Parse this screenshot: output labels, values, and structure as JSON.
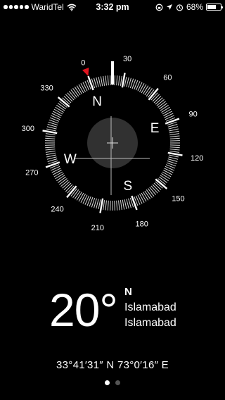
{
  "status_bar": {
    "carrier": "WaridTel",
    "time": "3:32 pm",
    "battery_percent": "68%",
    "battery_level": 0.68,
    "signal_bars": 5,
    "icons": [
      "wifi-icon",
      "rotation-lock-icon",
      "location-arrow-icon",
      "alarm-icon",
      "battery-icon"
    ]
  },
  "compass": {
    "heading_degrees": 20,
    "cardinals": [
      "N",
      "E",
      "S",
      "W"
    ],
    "degree_labels": [
      "0",
      "30",
      "60",
      "90",
      "120",
      "150",
      "180",
      "210",
      "240",
      "270",
      "300",
      "330"
    ],
    "colors": {
      "north_marker": "#e0141e",
      "ticks": "#ffffff",
      "level_bubble": "#3a3a3a"
    }
  },
  "readout": {
    "heading": "20°",
    "direction": "N",
    "location_line1": "Islamabad",
    "location_line2": "Islamabad"
  },
  "coordinates": "33°41′31″ N  73°0′16″ E",
  "pager": {
    "count": 2,
    "active_index": 0
  }
}
